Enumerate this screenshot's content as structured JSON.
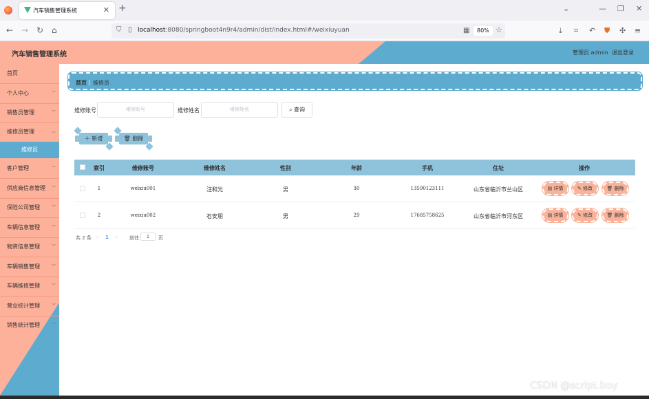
{
  "browser": {
    "tab_title": "汽车销售管理系统",
    "url_host": "localhost",
    "url_rest": ":8080/springboot4n9r4/admin/dist/index.html#/weixiuyuan",
    "zoom": "80%"
  },
  "header": {
    "app_title": "汽车销售管理系统",
    "admin_label": "管理员 admin",
    "logout": "退出登录"
  },
  "sidebar": {
    "items": [
      {
        "label": "首页"
      },
      {
        "label": "个人中心"
      },
      {
        "label": "销售员管理"
      },
      {
        "label": "维修员管理"
      },
      {
        "label": "维修员"
      },
      {
        "label": "客户管理"
      },
      {
        "label": "供应商信息管理"
      },
      {
        "label": "保险公司管理"
      },
      {
        "label": "车辆信息管理"
      },
      {
        "label": "物资信息管理"
      },
      {
        "label": "车辆销售管理"
      },
      {
        "label": "车辆维修管理"
      },
      {
        "label": "营业统计管理"
      },
      {
        "label": "销售统计管理"
      }
    ]
  },
  "breadcrumb": {
    "home": "首页",
    "separator": "|",
    "current": "维修员"
  },
  "search": {
    "account_label": "维修账号",
    "account_placeholder": "维修账号",
    "name_label": "维修姓名",
    "name_placeholder": "维修姓名",
    "search_button": "查询"
  },
  "actions": {
    "add": "新增",
    "delete": "删除"
  },
  "table": {
    "headers": {
      "index": "索引",
      "account": "维修账号",
      "name": "维修姓名",
      "gender": "性别",
      "age": "年龄",
      "phone": "手机",
      "address": "住址",
      "ops": "操作"
    },
    "rows": [
      {
        "index": "1",
        "account": "weixiu001",
        "name": "汪和光",
        "gender": "男",
        "age": "30",
        "phone": "13590123111",
        "address": "山东省临沂市兰山区"
      },
      {
        "index": "2",
        "account": "weixiu002",
        "name": "石安朋",
        "gender": "男",
        "age": "29",
        "phone": "17685758625",
        "address": "山东省临沂市河东区"
      }
    ],
    "op_labels": {
      "detail": "详情",
      "edit": "修改",
      "delete": "删除"
    }
  },
  "pagination": {
    "total": "共 2 条",
    "prev": "‹",
    "current": "1",
    "next": "›",
    "goto_label": "前往",
    "goto_value": "1",
    "page_unit": "页"
  },
  "watermark": "CSDN @script.boy",
  "colors": {
    "peach": "#fdb09a",
    "blue": "#5dacd0",
    "light_blue": "#8fc3dc"
  }
}
